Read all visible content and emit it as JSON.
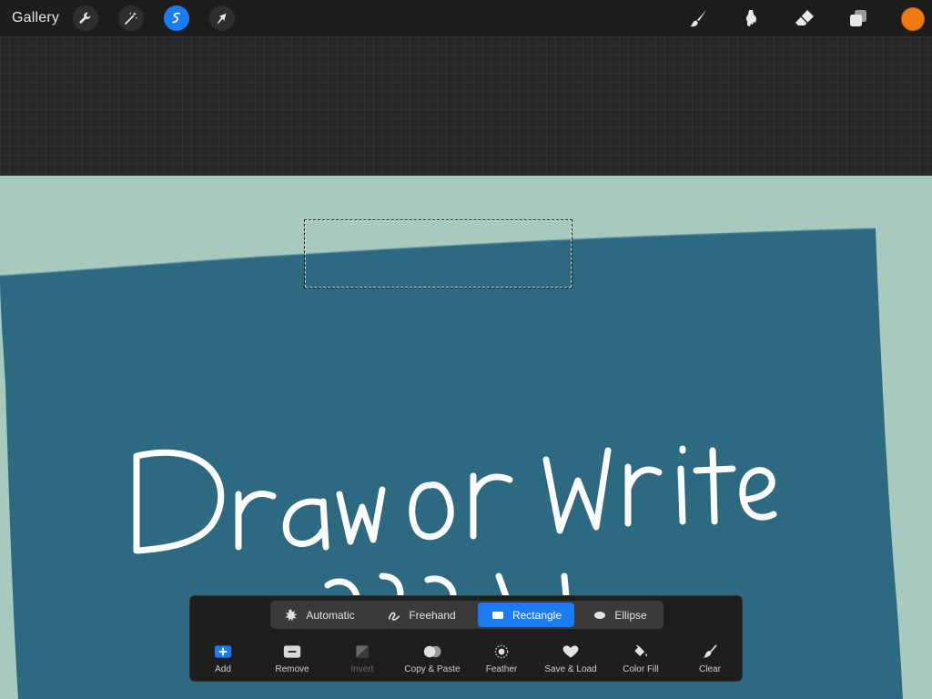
{
  "topbar": {
    "gallery_label": "Gallery",
    "left_tools": [
      "wrench-icon",
      "magic-wand-icon",
      "selection-icon",
      "transform-arrow-icon"
    ],
    "right_tools": [
      "brush-icon",
      "smudge-icon",
      "eraser-icon",
      "layers-icon"
    ],
    "active_tool": "selection",
    "current_color": "#f07a12",
    "accent_color": "#1a7bf2"
  },
  "canvas": {
    "background_color": "#a7c9be",
    "paper_color": "#2d6a82",
    "handwritten_text": "Draw or Write"
  },
  "selection_panel": {
    "modes": [
      {
        "label": "Automatic",
        "icon": "starburst-icon"
      },
      {
        "label": "Freehand",
        "icon": "freehand-icon"
      },
      {
        "label": "Rectangle",
        "icon": "rectangle-icon"
      },
      {
        "label": "Ellipse",
        "icon": "ellipse-icon"
      }
    ],
    "active_mode": "Rectangle",
    "actions": [
      {
        "label": "Add",
        "icon": "add-icon"
      },
      {
        "label": "Remove",
        "icon": "remove-icon"
      },
      {
        "label": "Invert",
        "icon": "invert-icon"
      },
      {
        "label": "Copy & Paste",
        "icon": "copy-paste-icon"
      },
      {
        "label": "Feather",
        "icon": "feather-icon"
      },
      {
        "label": "Save & Load",
        "icon": "heart-icon"
      },
      {
        "label": "Color Fill",
        "icon": "color-fill-icon"
      },
      {
        "label": "Clear",
        "icon": "clear-brush-icon"
      }
    ],
    "disabled_actions": [
      "Invert"
    ]
  }
}
